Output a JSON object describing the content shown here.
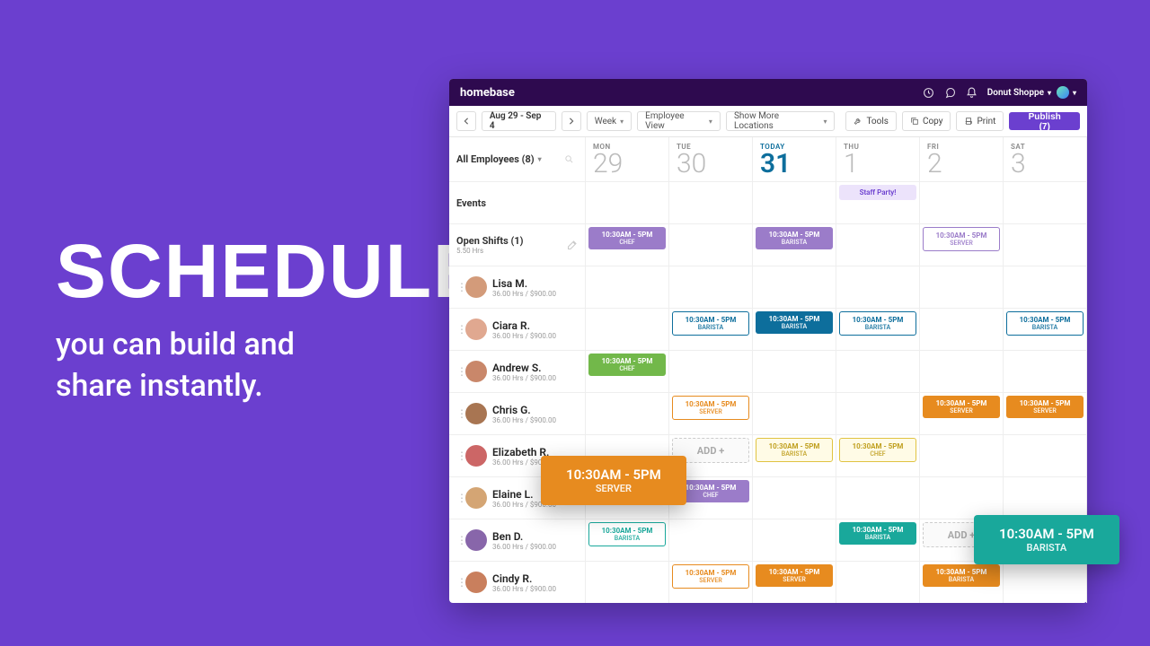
{
  "hero": {
    "title": "SCHEDULES",
    "line1": "you can build and",
    "line2": "share instantly."
  },
  "brand": "homebase",
  "account": "Donut Shoppe",
  "toolbar": {
    "range": "Aug 29 - Sep 4",
    "view": "Week",
    "mode": "Employee View",
    "locations": "Show More Locations",
    "tools": "Tools",
    "copy": "Copy",
    "print": "Print",
    "publish": "Publish (7)"
  },
  "filter": "All Employees (8)",
  "days": [
    {
      "dow": "MON",
      "num": "29"
    },
    {
      "dow": "TUE",
      "num": "30"
    },
    {
      "dow": "TODAY",
      "num": "31",
      "today": true
    },
    {
      "dow": "THU",
      "num": "1"
    },
    {
      "dow": "FRI",
      "num": "2"
    },
    {
      "dow": "SAT",
      "num": "3"
    }
  ],
  "events_label": "Events",
  "events": {
    "3": "Staff Party!"
  },
  "open": {
    "label": "Open Shifts (1)",
    "sub": "5.50 Hrs"
  },
  "emp_sub": "36.00 Hrs / $900.00",
  "shift_time": "10:30AM - 5PM",
  "roles": {
    "chef": "CHEF",
    "barista": "BARISTA",
    "server": "SERVER"
  },
  "add": "ADD +",
  "employees": [
    "Lisa M.",
    "Ciara R.",
    "Andrew S.",
    "Chris G.",
    "Elizabeth R.",
    "Elaine L.",
    "Ben D.",
    "Cindy R."
  ],
  "schedule": {
    "open": [
      {
        "c": 0,
        "s": "solid purple",
        "r": "chef"
      },
      {
        "c": 2,
        "s": "solid purple",
        "r": "barista"
      },
      {
        "c": 4,
        "s": "outline purple-o",
        "r": "server"
      }
    ],
    "rows": [
      [],
      [
        {
          "c": 1,
          "s": "outline teal-o",
          "r": "barista"
        },
        {
          "c": 2,
          "s": "solid tealA",
          "r": "barista"
        },
        {
          "c": 3,
          "s": "outline teal-o",
          "r": "barista"
        },
        {
          "c": 5,
          "s": "outline teal-o",
          "r": "barista"
        }
      ],
      [
        {
          "c": 0,
          "s": "solid green",
          "r": "chef"
        }
      ],
      [
        {
          "c": 1,
          "s": "outline orange-o",
          "r": "server"
        },
        {
          "c": 4,
          "s": "solid orange",
          "r": "server"
        },
        {
          "c": 5,
          "s": "solid orange",
          "r": "server"
        }
      ],
      [
        {
          "c": 1,
          "add": true
        },
        {
          "c": 2,
          "s": "outline yellow-o",
          "r": "barista"
        },
        {
          "c": 3,
          "s": "outline yellow-o",
          "r": "chef"
        }
      ],
      [
        {
          "c": 1,
          "s": "solid purple",
          "r": "chef"
        }
      ],
      [
        {
          "c": 0,
          "s": "outline cyan-o",
          "r": "barista"
        },
        {
          "c": 3,
          "s": "solid cyan",
          "r": "barista"
        },
        {
          "c": 4,
          "add": true
        },
        {
          "c": 5,
          "s": "solid cyan",
          "r": "barista"
        }
      ],
      [
        {
          "c": 1,
          "s": "outline orange-o",
          "r": "server"
        },
        {
          "c": 2,
          "s": "solid orange",
          "r": "server"
        },
        {
          "c": 4,
          "s": "solid orange",
          "r": "barista"
        }
      ]
    ]
  },
  "float": [
    {
      "time": "10:30AM - 5PM",
      "role": "SERVER"
    },
    {
      "time": "10:30AM - 5PM",
      "role": "BARISTA"
    }
  ],
  "avatar_colors": [
    "#d39b7a",
    "#e0a890",
    "#c9876a",
    "#a87552",
    "#cc6666",
    "#d4a574",
    "#8866aa",
    "#c97f5d"
  ]
}
